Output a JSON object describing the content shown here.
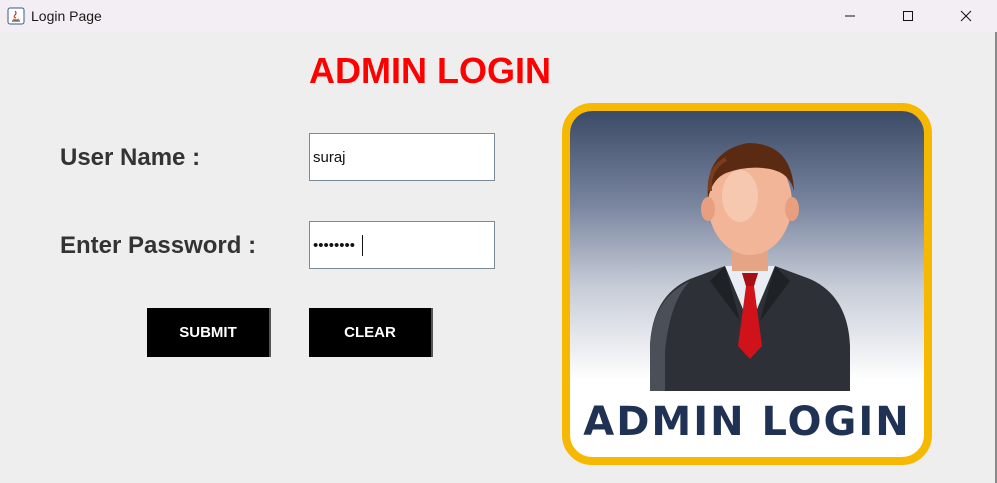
{
  "window": {
    "title": "Login Page",
    "controls": [
      "minimize-icon",
      "maximize-icon",
      "close-icon"
    ]
  },
  "form": {
    "heading": "ADMIN LOGIN",
    "username_label": "User Name :",
    "username_value": "suraj",
    "password_label": "Enter Password :",
    "password_value": "••••••••",
    "submit_label": "SUBMIT",
    "clear_label": "CLEAR"
  },
  "image": {
    "caption": "ADMIN LOGIN"
  },
  "colors": {
    "heading": "#ff0000",
    "button_bg": "#000000",
    "card_border": "#f6b800",
    "caption": "#1f3253"
  }
}
